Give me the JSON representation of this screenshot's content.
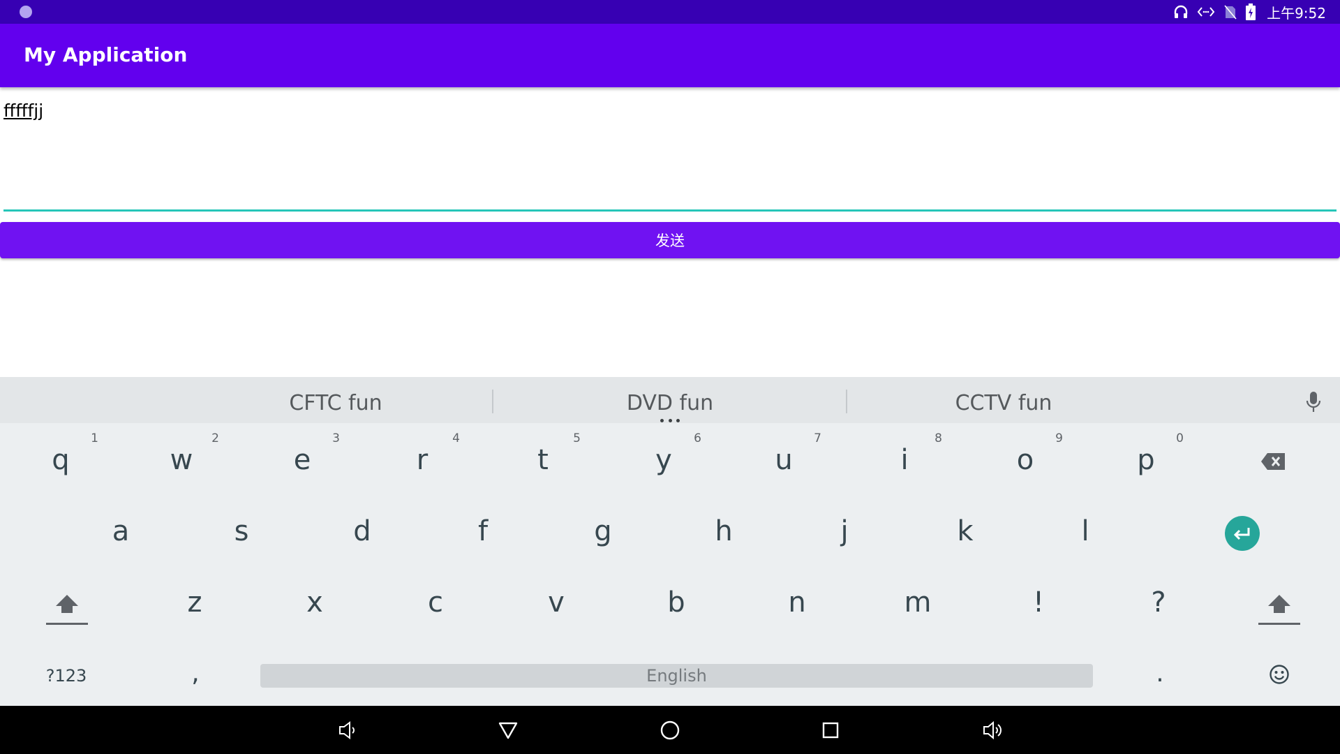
{
  "status_bar": {
    "time": "上午9:52",
    "icons": [
      "notification-dot-icon",
      "headphones-icon",
      "code-icon",
      "no-sim-icon",
      "battery-icon"
    ]
  },
  "app_bar": {
    "title": "My Application"
  },
  "message_input": {
    "value": "fffffjj",
    "accent_color": "#26c6b8"
  },
  "send_button": {
    "label": "发送",
    "color": "#7012f2"
  },
  "keyboard": {
    "suggestions": [
      "CFTC fun",
      "DVD fun",
      "CCTV fun"
    ],
    "row1": [
      {
        "key": "q",
        "hint": "1"
      },
      {
        "key": "w",
        "hint": "2"
      },
      {
        "key": "e",
        "hint": "3"
      },
      {
        "key": "r",
        "hint": "4"
      },
      {
        "key": "t",
        "hint": "5"
      },
      {
        "key": "y",
        "hint": "6"
      },
      {
        "key": "u",
        "hint": "7"
      },
      {
        "key": "i",
        "hint": "8"
      },
      {
        "key": "o",
        "hint": "9"
      },
      {
        "key": "p",
        "hint": "0"
      }
    ],
    "row2": [
      "a",
      "s",
      "d",
      "f",
      "g",
      "h",
      "j",
      "k",
      "l"
    ],
    "row3": [
      "z",
      "x",
      "c",
      "v",
      "b",
      "n",
      "m",
      "!",
      "?"
    ],
    "symbols_label": "?123",
    "comma": ",",
    "space_label": "English",
    "period": ".",
    "enter_color": "#26a69a",
    "background": "#eceff1"
  },
  "nav_bar": {
    "buttons": [
      "volume-down-icon",
      "back-icon",
      "home-icon",
      "recents-icon",
      "volume-up-icon"
    ]
  },
  "colors": {
    "status_bar": "#3700b3",
    "app_bar": "#6200ee"
  }
}
